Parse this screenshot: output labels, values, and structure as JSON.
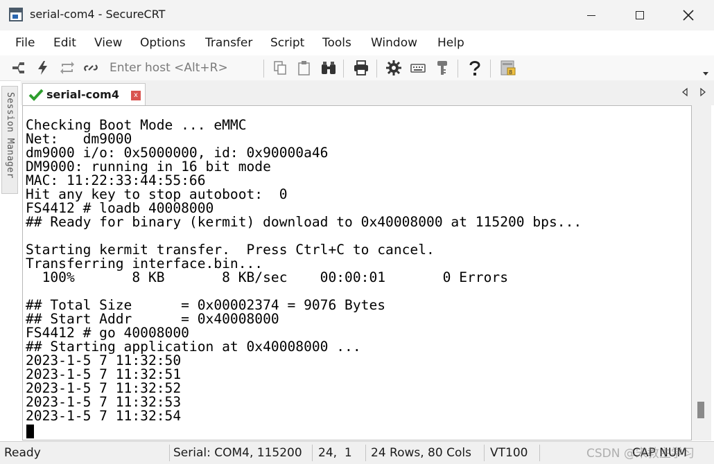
{
  "window": {
    "title": "serial-com4 - SecureCRT"
  },
  "menu": [
    "File",
    "Edit",
    "View",
    "Options",
    "Transfer",
    "Script",
    "Tools",
    "Window",
    "Help"
  ],
  "toolbar": {
    "host_placeholder": "Enter host <Alt+R>",
    "icons": [
      "connect-icon",
      "quick-connect-icon",
      "reconnect-icon",
      "disconnect-icon",
      "copy-icon",
      "paste-icon",
      "find-icon",
      "print-icon",
      "settings-icon",
      "keymap-icon",
      "key-icon",
      "help-icon",
      "sftp-icon"
    ]
  },
  "session_manager": {
    "label": "Session Manager"
  },
  "tab": {
    "label": "serial-com4",
    "close": "x"
  },
  "terminal": {
    "lines": [
      "Checking Boot Mode ... eMMC",
      "Net:   dm9000",
      "dm9000 i/o: 0x5000000, id: 0x90000a46",
      "DM9000: running in 16 bit mode",
      "MAC: 11:22:33:44:55:66",
      "Hit any key to stop autoboot:  0",
      "FS4412 # loadb 40008000",
      "## Ready for binary (kermit) download to 0x40008000 at 115200 bps...",
      "",
      "Starting kermit transfer.  Press Ctrl+C to cancel.",
      "Transferring interface.bin...",
      "  100%       8 KB       8 KB/sec    00:00:01       0 Errors",
      "",
      "## Total Size      = 0x00002374 = 9076 Bytes",
      "## Start Addr      = 0x40008000",
      "FS4412 # go 40008000",
      "## Starting application at 0x40008000 ...",
      "2023-1-5 7 11:32:50",
      "2023-1-5 7 11:32:51",
      "2023-1-5 7 11:32:52",
      "2023-1-5 7 11:32:53",
      "2023-1-5 7 11:32:54"
    ]
  },
  "status": {
    "ready": "Ready",
    "connection": "Serial: COM4, 115200",
    "position": "24,  1",
    "size": "24 Rows, 80 Cols",
    "emulation": "VT100",
    "caps": "CAP NUM"
  },
  "watermark": "CSDN @宋教主学习",
  "colors": {
    "check": "#2e9e2e",
    "tab_close": "#d9534f"
  }
}
